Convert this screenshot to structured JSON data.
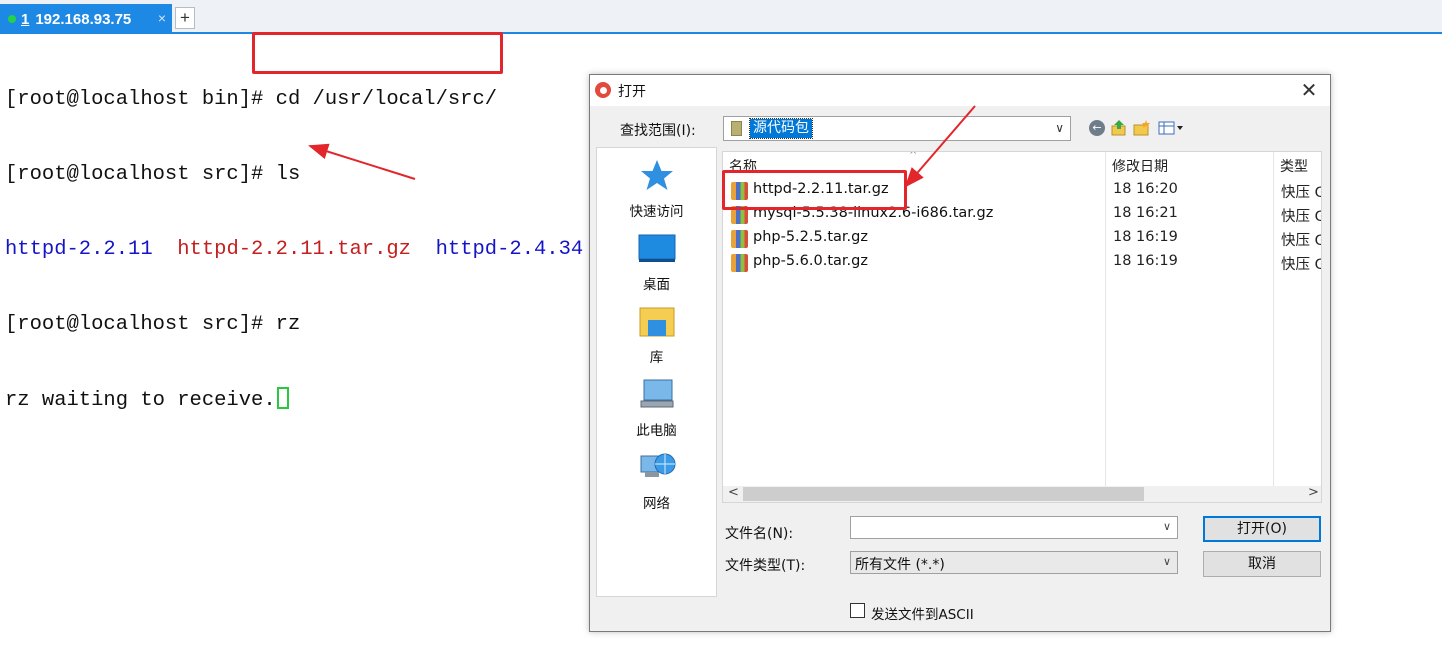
{
  "tab": {
    "number": "1",
    "title": "192.168.93.75",
    "close": "×",
    "new_tab": "+"
  },
  "terminal": {
    "lines": [
      {
        "prompt": "[root@localhost bin]# ",
        "command": "cd /usr/local/src/"
      },
      {
        "prompt": "[root@localhost src]# ",
        "command": "ls"
      },
      {
        "ls_items": [
          "httpd-2.2.11",
          "httpd-2.2.11.tar.gz",
          "httpd-2.4.34"
        ]
      },
      {
        "prompt": "[root@localhost src]# ",
        "command": "rz"
      },
      {
        "text": "rz waiting to receive."
      }
    ]
  },
  "dialog": {
    "title": "打开",
    "close": "✕",
    "look_in_label": "查找范围(I):",
    "look_in_value": "源代码包",
    "sidebar": [
      {
        "label": "快速访问"
      },
      {
        "label": "桌面"
      },
      {
        "label": "库"
      },
      {
        "label": "此电脑"
      },
      {
        "label": "网络"
      }
    ],
    "columns": {
      "name": "名称",
      "modified": "修改日期",
      "type": "类型"
    },
    "files": [
      {
        "name": "httpd-2.2.11.tar.gz",
        "modified": "18 16:20",
        "type": "快压 G"
      },
      {
        "name": "mysql-5.5.38-linux2.6-i686.tar.gz",
        "modified": "18 16:21",
        "type": "快压 G"
      },
      {
        "name": "php-5.2.5.tar.gz",
        "modified": "18 16:19",
        "type": "快压 G"
      },
      {
        "name": "php-5.6.0.tar.gz",
        "modified": "18 16:19",
        "type": "快压 G"
      }
    ],
    "filename_label": "文件名(N):",
    "filename_value": "",
    "filetype_label": "文件类型(T):",
    "filetype_value": "所有文件 (*.*)",
    "open_button": "打开(O)",
    "cancel_button": "取消",
    "ascii_checkbox_label": "发送文件到ASCII",
    "ascii_checked": false
  },
  "colors": {
    "annotation": "#e3262c",
    "tab_active": "#1e88e5",
    "selection": "#0078d7"
  }
}
